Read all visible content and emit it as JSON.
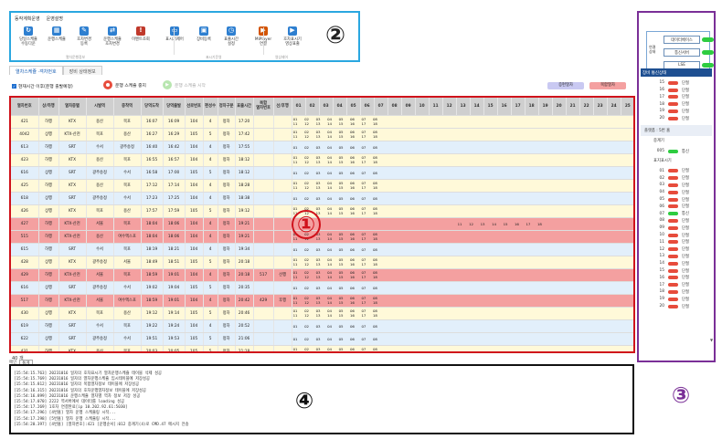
{
  "toolbar": {
    "menu": [
      "동작계획운영",
      "운영설명"
    ],
    "buttons": [
      {
        "label": "당일스케쥴\n수동다운",
        "icon": "refresh-icon",
        "color": "#2e7fd0"
      },
      {
        "label": "운행스케쥴",
        "icon": "calendar-icon",
        "color": "#2e7fd0"
      },
      {
        "label": "호차변경\n등록",
        "icon": "edit-icon",
        "color": "#2e7fd0"
      },
      {
        "label": "운행스케쥴\n호차변경",
        "icon": "swap-icon",
        "color": "#2e7fd0"
      },
      {
        "label": "이벤트조회",
        "icon": "alert-icon",
        "color": "#c0392b"
      },
      {
        "label": "표시기제어",
        "icon": "monitor-icon",
        "color": "#2e7fd0"
      },
      {
        "label": "장비등록",
        "icon": "device-icon",
        "color": "#2e7fd0"
      },
      {
        "label": "표출시간\n설정",
        "icon": "clock-icon",
        "color": "#2e7fd0"
      },
      {
        "label": "MiPlayer\n연결",
        "icon": "player-icon",
        "color": "#d35400"
      },
      {
        "label": "호차표시기\n영상표출",
        "icon": "video-icon",
        "color": "#2e7fd0"
      }
    ],
    "groups": [
      "열차운행정보",
      "표시기운영",
      "영상제어"
    ]
  },
  "markers": {
    "m1": "①",
    "m2": "②",
    "m3": "③",
    "m4": "④"
  },
  "tabs": [
    "열차스케쥴 ·객차번호",
    "장비 상태정보"
  ],
  "controls": {
    "checkbox_label": "현재시간 이후(운행 출발예정)",
    "stop_label": "운행 스케쥴 중지",
    "start_label": "운행 스케쥴 시작",
    "legend1": "증편열차",
    "legend2": "복합열차"
  },
  "table": {
    "headers": [
      "열차번호",
      "상/하행",
      "열차종별",
      "시발역",
      "종착역",
      "당역도착",
      "당역출발",
      "선로번호",
      "편성수",
      "정차구분",
      "표출시간",
      "복합\n열차번호",
      "선/후행",
      "01",
      "02",
      "03",
      "04",
      "05",
      "06",
      "07",
      "08",
      "09",
      "10",
      "11",
      "12",
      "13",
      "14",
      "15",
      "16",
      "17",
      "18",
      "19",
      "20",
      "21",
      "22",
      "23",
      "24",
      "25"
    ],
    "rows": [
      {
        "v": [
          "421",
          "하행",
          "KTX",
          "용산",
          "목포",
          "16:07",
          "16:09",
          "104",
          "4",
          "정차",
          "17:20",
          "",
          ""
        ],
        "c": "yellow",
        "o": "01 02 03 04 05 06 07 08 | 11 12 13 14 15 16 17 18"
      },
      {
        "v": [
          "4042",
          "상행",
          "KTX-산천",
          "목포",
          "용산",
          "16:27",
          "16:29",
          "105",
          "5",
          "정차",
          "17:42",
          "",
          ""
        ],
        "c": "yellow",
        "o": "01 02 03 04 05 06 07 08 | 11 12 13 14 15 16 17 18"
      },
      {
        "v": [
          "613",
          "하행",
          "SRT",
          "수서",
          "광주송정",
          "16:40",
          "16:42",
          "104",
          "4",
          "정차",
          "17:55",
          "",
          ""
        ],
        "c": "blue",
        "o": "01 02 03 04 05 06 07 08"
      },
      {
        "v": [
          "423",
          "하행",
          "KTX",
          "용산",
          "목포",
          "16:55",
          "16:57",
          "104",
          "4",
          "정차",
          "18:12",
          "",
          ""
        ],
        "c": "yellow",
        "o": "01 02 03 04 05 06 07 08 | 11 12 13 14 15 16 17 18"
      },
      {
        "v": [
          "616",
          "상행",
          "SRT",
          "광주송정",
          "수서",
          "16:58",
          "17:00",
          "105",
          "5",
          "정차",
          "18:12",
          "",
          ""
        ],
        "c": "blue",
        "o": "01 02 03 04 05 06 07 08"
      },
      {
        "v": [
          "425",
          "하행",
          "KTX",
          "용산",
          "목포",
          "17:12",
          "17:14",
          "104",
          "4",
          "정차",
          "18:28",
          "",
          ""
        ],
        "c": "yellow",
        "o": "01 02 03 04 05 06 07 08 | 11 12 13 14 15 16 17 18"
      },
      {
        "v": [
          "618",
          "상행",
          "SRT",
          "광주송정",
          "수서",
          "17:23",
          "17:25",
          "104",
          "4",
          "정차",
          "18:38",
          "",
          ""
        ],
        "c": "blue",
        "o": "01 02 03 04 05 06 07 08"
      },
      {
        "v": [
          "426",
          "상행",
          "KTX",
          "목포",
          "용산",
          "17:57",
          "17:59",
          "105",
          "5",
          "정차",
          "19:12",
          "",
          ""
        ],
        "c": "yellow",
        "o": "01 02 03 04 05 06 07 08 | 11 12 13 14 15 16 17 18"
      },
      {
        "v": [
          "427",
          "하행",
          "KTX-산천",
          "서울",
          "목포",
          "18:04",
          "18:06",
          "104",
          "4",
          "정차",
          "19:21",
          "",
          ""
        ],
        "c": "red",
        "o": "11 12 13 14 15 16 17 18"
      },
      {
        "v": [
          "515",
          "하행",
          "KTX-산천",
          "용산",
          "여수엑스포",
          "18:04",
          "18:06",
          "104",
          "4",
          "정차",
          "19:21",
          "",
          ""
        ],
        "c": "red",
        "o": "01 02 03 04 05 06 07 08 | 11 12 13 14 15 16 17 18"
      },
      {
        "v": [
          "615",
          "하행",
          "SRT",
          "수서",
          "목포",
          "18:19",
          "18:21",
          "104",
          "4",
          "정차",
          "19:34",
          "",
          ""
        ],
        "c": "blue",
        "o": "01 02 03 04 05 06 07 08"
      },
      {
        "v": [
          "428",
          "상행",
          "KTX",
          "광주송정",
          "서울",
          "18:49",
          "18:51",
          "105",
          "5",
          "정차",
          "20:18",
          "",
          ""
        ],
        "c": "yellow",
        "o": "01 02 03 04 05 06 07 08 | 11 12 13 14 15 16 17 18"
      },
      {
        "v": [
          "429",
          "하행",
          "KTX-산천",
          "서울",
          "목포",
          "18:59",
          "19:01",
          "104",
          "4",
          "정차",
          "20:18",
          "517",
          "선행"
        ],
        "c": "red",
        "o": "01 02 03 04 05 06 07 08 | 11 12 13 14 15 16 17 18"
      },
      {
        "v": [
          "616",
          "상행",
          "SRT",
          "광주송정",
          "수서",
          "19:02",
          "19:04",
          "105",
          "5",
          "정차",
          "20:35",
          "",
          ""
        ],
        "c": "blue",
        "o": "01 02 03 04 05 06 07 08"
      },
      {
        "v": [
          "517",
          "하행",
          "KTX-산천",
          "서울",
          "여수엑스포",
          "18:59",
          "19:01",
          "104",
          "4",
          "정차",
          "20:42",
          "429",
          "후행"
        ],
        "c": "red",
        "o": "01 02 03 04 05 06 07 08 | 11 12 13 14 15 16 17 18"
      },
      {
        "v": [
          "430",
          "상행",
          "KTX",
          "목포",
          "용산",
          "19:12",
          "19:14",
          "105",
          "5",
          "정차",
          "20:46",
          "",
          ""
        ],
        "c": "yellow",
        "o": "01 02 03 04 05 06 07 08 | 11 12 13 14 15 16 17 18"
      },
      {
        "v": [
          "619",
          "하행",
          "SRT",
          "수서",
          "목포",
          "19:22",
          "19:24",
          "104",
          "4",
          "정차",
          "20:52",
          "",
          ""
        ],
        "c": "blue",
        "o": "01 02 03 04 05 06 07 08"
      },
      {
        "v": [
          "622",
          "상행",
          "SRT",
          "광주송정",
          "수서",
          "19:51",
          "19:53",
          "105",
          "5",
          "정차",
          "21:06",
          "",
          ""
        ],
        "c": "blue",
        "o": "01 02 03 04 05 06 07 08"
      },
      {
        "v": [
          "431",
          "하행",
          "KTX",
          "용산",
          "목포",
          "20:03",
          "20:05",
          "105",
          "5",
          "정차",
          "21:18",
          "",
          ""
        ],
        "c": "yellow",
        "o": "01 02 03 04 05 06 07 08 | 11 12 13 14 15 16 17 18"
      }
    ]
  },
  "count": "40 개",
  "log": {
    "tabs": [
      "메인",
      "통계"
    ],
    "lines": [
      "[15:54:15.763] 20231016 일자의 호차표시기 열차운행스케쥴 테이블 삭제 성공",
      "[15:54:15.769] 20231016 일자의 열차운행스케쥴 임시테이블에 저장성공",
      "[15:54:15.812] 20231016 일자의 복합열차정보 테이블에 저장성공",
      "[15:54:16.315] 20231016 일자의 호차운행열차정보 테이블에 저장성공",
      "[15:54:16.899] 20231016 운행스케쥴 열차별 역차 정보 저장 성공",
      "[15:54:17.070] 2222 역서버에서 데이터를 loading 성공",
      "[15:54:17.269] 1호차 연결완료[ip 10.202.92.61:5030]",
      "[15:54:17.296] [4번홈] 열차 운행 스케쥴링 시작...",
      "[15:54:17.298] [5번홈] 열차 운행 스케쥴링 시작...",
      "[15:54:20.397] [4번홈] [열차번호]:421 [운행순서]:012 중계기(4)로 CMD.47 메시지 전송"
    ]
  },
  "side": {
    "conn_label": "연결\n상태",
    "conn": [
      {
        "label": "데이터베이스",
        "status": "green"
      },
      {
        "label": "통신서버",
        "status": "green"
      },
      {
        "label": "LSE",
        "status": "green"
      }
    ],
    "status_title": "장비 통신상태",
    "list1": [
      {
        "n": "15",
        "s": "단절"
      },
      {
        "n": "16",
        "s": "단절"
      },
      {
        "n": "17",
        "s": "단절"
      },
      {
        "n": "18",
        "s": "단절"
      },
      {
        "n": "19",
        "s": "단절"
      },
      {
        "n": "20",
        "s": "단절"
      }
    ],
    "head2": "플랫폼 : 5번 홈",
    "head3": "중계기",
    "relay": {
      "n": "005",
      "s": "통신"
    },
    "head4": "표지표시기",
    "list2": [
      {
        "n": "01",
        "s": "단절"
      },
      {
        "n": "02",
        "s": "단절"
      },
      {
        "n": "03",
        "s": "단절"
      },
      {
        "n": "04",
        "s": "단절"
      },
      {
        "n": "05",
        "s": "단절"
      },
      {
        "n": "06",
        "s": "단절"
      },
      {
        "n": "07",
        "s": "통신"
      },
      {
        "n": "08",
        "s": "단절"
      },
      {
        "n": "09",
        "s": "단절"
      },
      {
        "n": "10",
        "s": "단절"
      },
      {
        "n": "11",
        "s": "단절"
      },
      {
        "n": "12",
        "s": "단절"
      },
      {
        "n": "13",
        "s": "단절"
      },
      {
        "n": "14",
        "s": "단절"
      },
      {
        "n": "15",
        "s": "단절"
      },
      {
        "n": "16",
        "s": "단절"
      },
      {
        "n": "17",
        "s": "단절"
      },
      {
        "n": "18",
        "s": "단절"
      },
      {
        "n": "19",
        "s": "단절"
      },
      {
        "n": "20",
        "s": "단절"
      }
    ]
  },
  "colors": {
    "green": "#2ecc40",
    "red": "#e74c3c",
    "row_red": "#f4a0a0",
    "row_yellow": "#fff9d9",
    "row_blue": "#e2effb",
    "header": "#1e4f91"
  }
}
